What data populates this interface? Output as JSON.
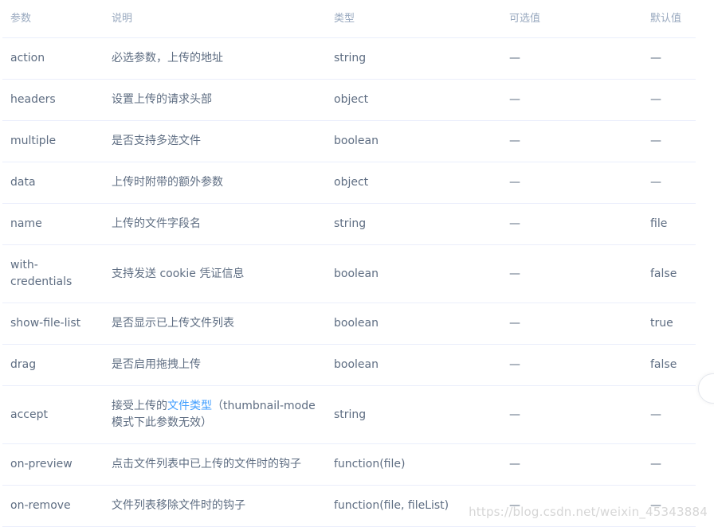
{
  "table": {
    "headers": [
      "参数",
      "说明",
      "类型",
      "可选值",
      "默认值"
    ],
    "rows": [
      {
        "param": "action",
        "desc": "必选参数，上传的地址",
        "type": "string",
        "options": "—",
        "default": "—"
      },
      {
        "param": "headers",
        "desc": "设置上传的请求头部",
        "type": "object",
        "options": "—",
        "default": "—"
      },
      {
        "param": "multiple",
        "desc": "是否支持多选文件",
        "type": "boolean",
        "options": "—",
        "default": "—"
      },
      {
        "param": "data",
        "desc": "上传时附带的额外参数",
        "type": "object",
        "options": "—",
        "default": "—"
      },
      {
        "param": "name",
        "desc": "上传的文件字段名",
        "type": "string",
        "options": "—",
        "default": "file"
      },
      {
        "param": "with-credentials",
        "desc": "支持发送 cookie 凭证信息",
        "type": "boolean",
        "options": "—",
        "default": "false"
      },
      {
        "param": "show-file-list",
        "desc": "是否显示已上传文件列表",
        "type": "boolean",
        "options": "—",
        "default": "true"
      },
      {
        "param": "drag",
        "desc": "是否启用拖拽上传",
        "type": "boolean",
        "options": "—",
        "default": "false"
      },
      {
        "param": "accept",
        "desc_prefix": "接受上传的",
        "desc_link": "文件类型",
        "desc_suffix": "（thumbnail-mode 模式下此参数无效）",
        "type": "string",
        "options": "—",
        "default": "—"
      },
      {
        "param": "on-preview",
        "desc": "点击文件列表中已上传的文件时的钩子",
        "type": "function(file)",
        "options": "—",
        "default": "—"
      },
      {
        "param": "on-remove",
        "desc": "文件列表移除文件时的钩子",
        "type": "function(file, fileList)",
        "options": "—",
        "default": "—"
      }
    ]
  },
  "watermark": "https://blog.csdn.net/weixin_45343884",
  "colors": {
    "text": "#5e6d82",
    "header_text": "#99a9bf",
    "border": "#eaeefb",
    "link": "#409eff"
  }
}
